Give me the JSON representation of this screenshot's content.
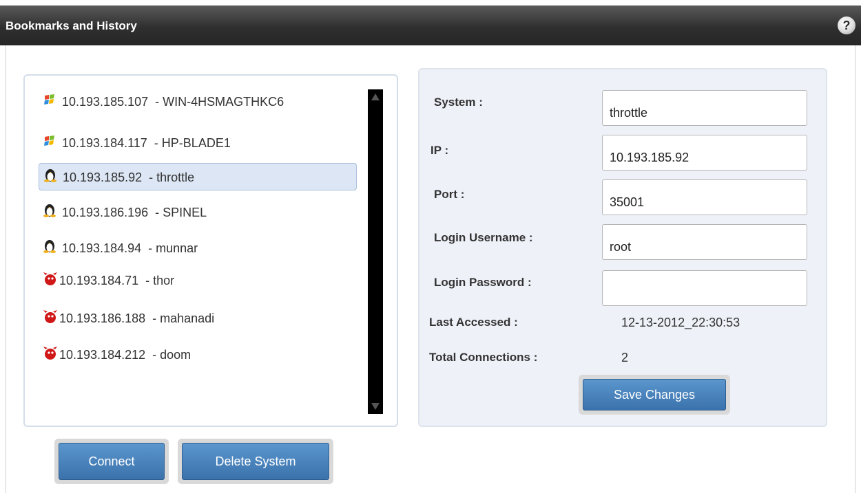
{
  "titlebar": {
    "title": "Bookmarks and History",
    "help_label": "?"
  },
  "list": {
    "items": [
      {
        "ip": "10.193.185.107",
        "name": "WIN-4HSMAGTHKC6",
        "os_icon": "windows-icon"
      },
      {
        "ip": "10.193.184.117",
        "name": "HP-BLADE1",
        "os_icon": "windows-icon"
      },
      {
        "ip": "10.193.185.92",
        "name": "throttle",
        "os_icon": "linux-icon"
      },
      {
        "ip": "10.193.186.196",
        "name": "SPINEL",
        "os_icon": "linux-icon"
      },
      {
        "ip": "10.193.184.94",
        "name": "munnar",
        "os_icon": "linux-icon"
      },
      {
        "ip": "10.193.184.71",
        "name": "thor",
        "os_icon": "bsd-icon"
      },
      {
        "ip": "10.193.186.188",
        "name": "mahanadi",
        "os_icon": "bsd-icon"
      },
      {
        "ip": "10.193.184.212",
        "name": "doom",
        "os_icon": "bsd-icon"
      }
    ],
    "selected_index": 2,
    "separator": " - "
  },
  "details": {
    "system_label": "System :",
    "system_value": "throttle",
    "ip_label": "IP :",
    "ip_value": "10.193.185.92",
    "port_label": "Port :",
    "port_value": "35001",
    "username_label": "Login Username :",
    "username_value": "root",
    "password_label": "Login Password :",
    "password_value": "",
    "last_accessed_label": "Last Accessed :",
    "last_accessed_value": "12-13-2012_22:30:53",
    "total_connections_label": "Total Connections :",
    "total_connections_value": "2",
    "save_label": "Save Changes"
  },
  "actions": {
    "connect_label": "Connect",
    "delete_label": "Delete System"
  },
  "colors": {
    "accent": "#4a85bf",
    "selection": "#dce6f4",
    "titlebar": "#3a3a3a"
  }
}
